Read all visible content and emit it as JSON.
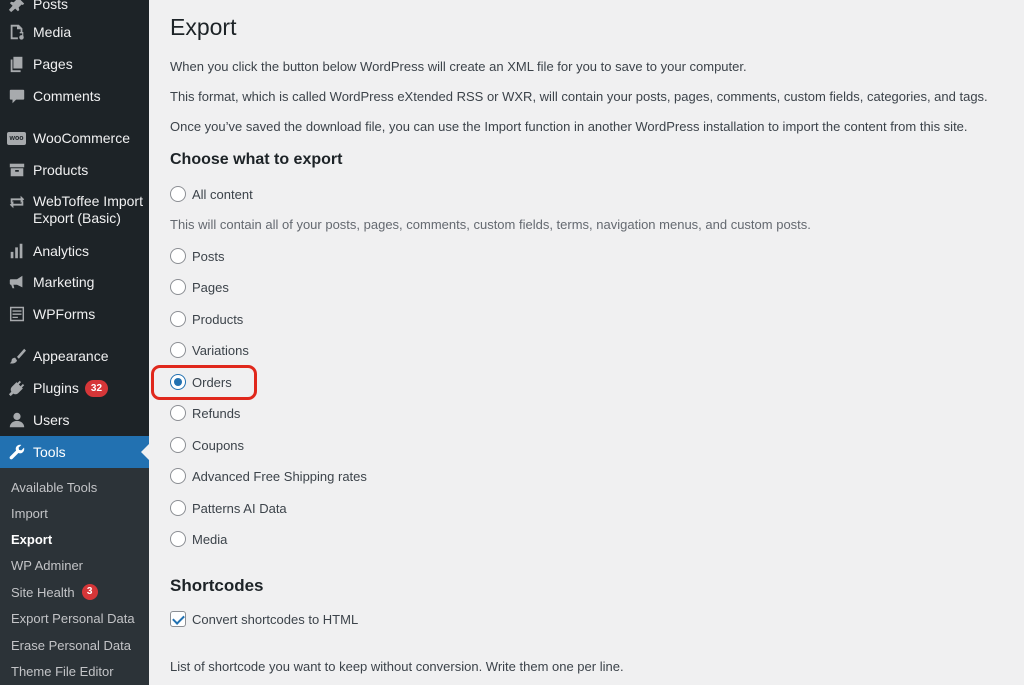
{
  "sidebar": {
    "items": [
      {
        "label": "Posts",
        "icon": "pin-icon"
      },
      {
        "label": "Media",
        "icon": "media-icon"
      },
      {
        "label": "Pages",
        "icon": "pages-icon"
      },
      {
        "label": "Comments",
        "icon": "comments-icon"
      },
      {
        "label": "WooCommerce",
        "icon": "woocommerce-icon",
        "icon_text": "woo"
      },
      {
        "label": "Products",
        "icon": "products-icon"
      },
      {
        "label": "WebToffee Import Export (Basic)",
        "line1": "WebToffee Import",
        "line2": "Export (Basic)",
        "icon": "import-export-icon"
      },
      {
        "label": "Analytics",
        "icon": "analytics-icon"
      },
      {
        "label": "Marketing",
        "icon": "megaphone-icon"
      },
      {
        "label": "WPForms",
        "icon": "forms-icon"
      },
      {
        "label": "Appearance",
        "icon": "paintbrush-icon"
      },
      {
        "label": "Plugins",
        "icon": "plugins-icon",
        "badge": "32"
      },
      {
        "label": "Users",
        "icon": "users-icon"
      },
      {
        "label": "Tools",
        "icon": "wrench-icon",
        "active": true
      }
    ],
    "submenu": [
      {
        "label": "Available Tools"
      },
      {
        "label": "Import"
      },
      {
        "label": "Export",
        "current": true
      },
      {
        "label": "WP Adminer"
      },
      {
        "label": "Site Health",
        "badge": "3"
      },
      {
        "label": "Export Personal Data"
      },
      {
        "label": "Erase Personal Data"
      },
      {
        "label": "Theme File Editor"
      }
    ]
  },
  "main": {
    "title": "Export",
    "intro": [
      "When you click the button below WordPress will create an XML file for you to save to your computer.",
      "This format, which is called WordPress eXtended RSS or WXR, will contain your posts, pages, comments, custom fields, categories, and tags.",
      "Once you’ve saved the download file, you can use the Import function in another WordPress installation to import the content from this site."
    ],
    "choose_heading": "Choose what to export",
    "all_content": {
      "label": "All content",
      "checked": false
    },
    "all_content_note": "This will contain all of your posts, pages, comments, custom fields, terms, navigation menus, and custom posts.",
    "options": [
      {
        "label": "Posts",
        "checked": false
      },
      {
        "label": "Pages",
        "checked": false
      },
      {
        "label": "Products",
        "checked": false
      },
      {
        "label": "Variations",
        "checked": false
      },
      {
        "label": "Orders",
        "checked": true
      },
      {
        "label": "Refunds",
        "checked": false
      },
      {
        "label": "Coupons",
        "checked": false
      },
      {
        "label": "Advanced Free Shipping rates",
        "checked": false
      },
      {
        "label": "Patterns AI Data",
        "checked": false
      },
      {
        "label": "Media",
        "checked": false
      }
    ],
    "shortcodes_heading": "Shortcodes",
    "convert_shortcodes": {
      "label": "Convert shortcodes to HTML",
      "checked": true
    },
    "shortcode_note": "List of shortcode you want to keep without conversion. Write them one per line."
  },
  "colors": {
    "sidebar_bg": "#1d2327",
    "submenu_bg": "#2c3338",
    "accent": "#2271b1",
    "badge": "#d63638",
    "highlight": "#e0281c",
    "content_bg": "#f0f0f1"
  }
}
